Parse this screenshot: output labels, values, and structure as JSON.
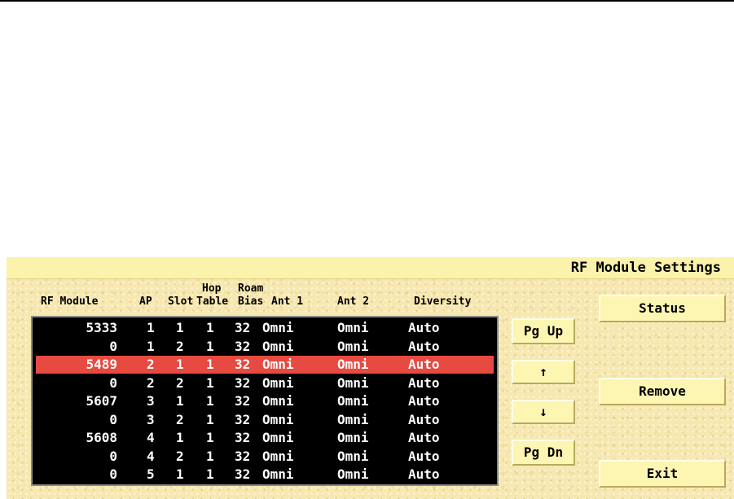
{
  "panel": {
    "title": "RF Module Settings"
  },
  "table": {
    "headers": {
      "rf_module": "RF Module",
      "ap": "AP",
      "slot": "Slot",
      "hop_table_top": "Hop",
      "hop_table_bottom": "Table",
      "roam_bias_top": "Roam",
      "roam_bias_bottom": "Bias",
      "ant1": "Ant 1",
      "ant2": "Ant 2",
      "diversity": "Diversity"
    },
    "selected_index": 2,
    "rows": [
      {
        "rf_module": "5333",
        "ap": "1",
        "slot": "1",
        "hop": "1",
        "roam": "32",
        "ant1": "Omni",
        "ant2": "Omni",
        "diversity": "Auto"
      },
      {
        "rf_module": "0",
        "ap": "1",
        "slot": "2",
        "hop": "1",
        "roam": "32",
        "ant1": "Omni",
        "ant2": "Omni",
        "diversity": "Auto"
      },
      {
        "rf_module": "5489",
        "ap": "2",
        "slot": "1",
        "hop": "1",
        "roam": "32",
        "ant1": "Omni",
        "ant2": "Omni",
        "diversity": "Auto"
      },
      {
        "rf_module": "0",
        "ap": "2",
        "slot": "2",
        "hop": "1",
        "roam": "32",
        "ant1": "Omni",
        "ant2": "Omni",
        "diversity": "Auto"
      },
      {
        "rf_module": "5607",
        "ap": "3",
        "slot": "1",
        "hop": "1",
        "roam": "32",
        "ant1": "Omni",
        "ant2": "Omni",
        "diversity": "Auto"
      },
      {
        "rf_module": "0",
        "ap": "3",
        "slot": "2",
        "hop": "1",
        "roam": "32",
        "ant1": "Omni",
        "ant2": "Omni",
        "diversity": "Auto"
      },
      {
        "rf_module": "5608",
        "ap": "4",
        "slot": "1",
        "hop": "1",
        "roam": "32",
        "ant1": "Omni",
        "ant2": "Omni",
        "diversity": "Auto"
      },
      {
        "rf_module": "0",
        "ap": "4",
        "slot": "2",
        "hop": "1",
        "roam": "32",
        "ant1": "Omni",
        "ant2": "Omni",
        "diversity": "Auto"
      },
      {
        "rf_module": "0",
        "ap": "5",
        "slot": "1",
        "hop": "1",
        "roam": "32",
        "ant1": "Omni",
        "ant2": "Omni",
        "diversity": "Auto"
      }
    ]
  },
  "buttons": {
    "pg_up": "Pg Up",
    "up": "↑",
    "down": "↓",
    "pg_dn": "Pg Dn",
    "status": "Status",
    "remove": "Remove",
    "exit": "Exit"
  },
  "colors": {
    "panel_bg": "#f6e8b0",
    "titlebar_bg": "#fbf2ab",
    "list_bg": "#000000",
    "selection": "#e74a40",
    "button_bg": "#fdf6b2"
  }
}
